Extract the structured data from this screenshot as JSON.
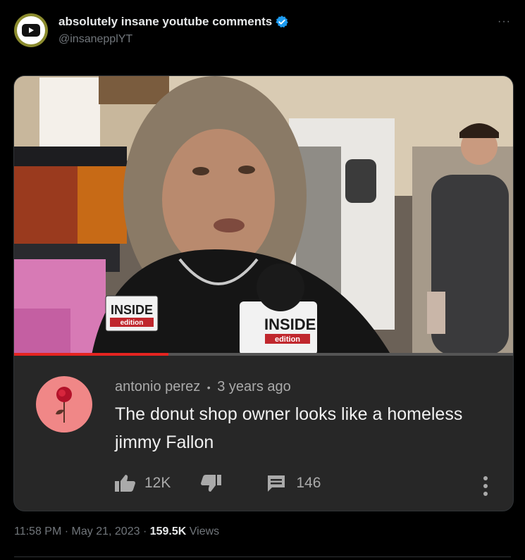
{
  "tweet": {
    "author_name": "absolutely insane youtube comments",
    "handle": "@insanepplYT",
    "verified": true,
    "accent_color": "#1d9bf0",
    "time": "11:58 PM",
    "date": "May 21, 2023",
    "views_count": "159.5K",
    "views_label": "Views",
    "more_label": "···"
  },
  "video": {
    "progress_fraction": 0.31,
    "progress_color": "#e52420",
    "watermark_line1": "INSIDE",
    "watermark_line2": "edition",
    "mic_line1": "INSIDE",
    "mic_line2": "edition"
  },
  "comment": {
    "username": "antonio perez",
    "separator": "•",
    "time_ago": "3 years ago",
    "text": "The donut shop owner looks like a homeless jimmy Fallon",
    "likes": "12K",
    "replies": "146",
    "icons": [
      "thumbs-up-icon",
      "thumbs-down-icon",
      "reply-icon",
      "more-vertical-icon"
    ]
  }
}
